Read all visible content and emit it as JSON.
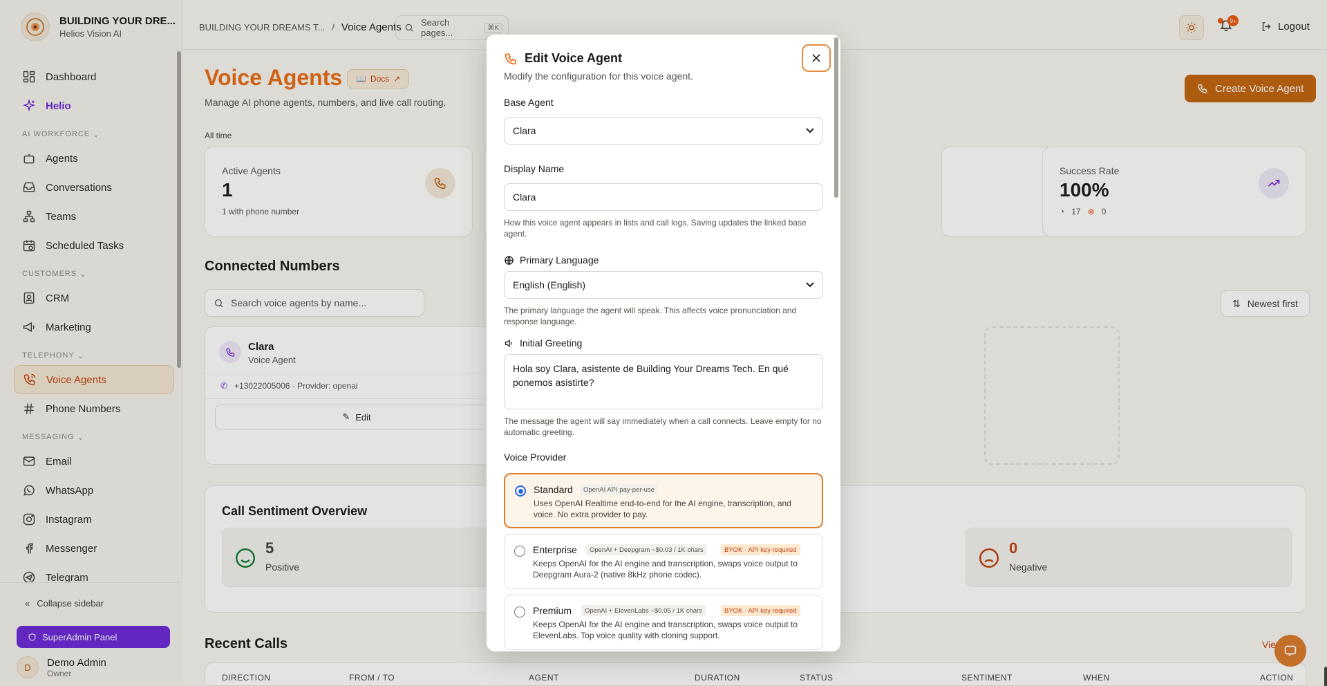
{
  "brand": {
    "name": "BUILDING YOUR DRE...",
    "sub": "Helios Vision AI"
  },
  "sidebar": {
    "items": [
      {
        "label": "Dashboard"
      },
      {
        "label": "Helio"
      },
      {
        "section": "AI WORKFORCE"
      },
      {
        "label": "Agents"
      },
      {
        "label": "Conversations"
      },
      {
        "label": "Teams"
      },
      {
        "label": "Scheduled Tasks"
      },
      {
        "section": "CUSTOMERS"
      },
      {
        "label": "CRM"
      },
      {
        "label": "Marketing"
      },
      {
        "section": "TELEPHONY"
      },
      {
        "label": "Voice Agents"
      },
      {
        "label": "Phone Numbers"
      },
      {
        "section": "MESSAGING"
      },
      {
        "label": "Email"
      },
      {
        "label": "WhatsApp"
      },
      {
        "label": "Instagram"
      },
      {
        "label": "Messenger"
      },
      {
        "label": "Telegram"
      }
    ],
    "collapse": "Collapse sidebar",
    "superadmin": "SuperAdmin Panel",
    "user": {
      "initial": "D",
      "name": "Demo Admin",
      "role": "Owner"
    }
  },
  "header": {
    "breadcrumb_root": "BUILDING YOUR DREAMS T...",
    "breadcrumb_sep": "/",
    "breadcrumb_current": "Voice Agents",
    "search_placeholder": "Search pages...",
    "search_kbd": "⌘K",
    "notif_badge": "9+",
    "logout": "Logout"
  },
  "page": {
    "title": "Voice Agents",
    "docs": "Docs",
    "subtitle": "Manage AI phone agents, numbers, and live call routing.",
    "create": "Create Voice Agent",
    "period": "All time"
  },
  "stats": {
    "active": {
      "label": "Active Agents",
      "value": "1",
      "note": "1 with phone number"
    },
    "success": {
      "label": "Success Rate",
      "value": "100%",
      "ok": "17",
      "fail": "0"
    }
  },
  "connected": {
    "title": "Connected Numbers",
    "search_placeholder": "Search voice agents by name...",
    "sort": "Newest first",
    "card": {
      "name": "Clara",
      "type": "Voice Agent",
      "phone": "+13022005006 · Provider: openai",
      "edit": "Edit"
    }
  },
  "sentiment": {
    "title": "Call Sentiment Overview",
    "positive": {
      "value": "5",
      "label": "Positive"
    },
    "negative": {
      "value": "0",
      "label": "Negative"
    }
  },
  "recent": {
    "title": "Recent Calls",
    "view_all": "View all",
    "columns": [
      "DIRECTION",
      "FROM / TO",
      "AGENT",
      "DURATION",
      "STATUS",
      "SENTIMENT",
      "WHEN",
      "ACTION"
    ]
  },
  "modal": {
    "title": "Edit Voice Agent",
    "desc": "Modify the configuration for this voice agent.",
    "base_agent": {
      "label": "Base Agent",
      "value": "Clara"
    },
    "display_name": {
      "label": "Display Name",
      "value": "Clara",
      "help": "How this voice agent appears in lists and call logs. Saving updates the linked base agent."
    },
    "language": {
      "label": "Primary Language",
      "value": "English (English)",
      "help": "The primary language the agent will speak. This affects voice pronunciation and response language."
    },
    "greeting": {
      "label": "Initial Greeting",
      "value": "Hola soy Clara, asistente de Building Your Dreams Tech. En qué ponemos asistirte?",
      "help": "The message the agent will say immediately when a call connects. Leave empty for no automatic greeting."
    },
    "provider": {
      "label": "Voice Provider",
      "options": [
        {
          "name": "Standard",
          "chip": "OpenAI API pay-per-use",
          "byok": "",
          "desc": "Uses OpenAI Realtime end-to-end for the AI engine, transcription, and voice. No extra provider to pay.",
          "selected": true
        },
        {
          "name": "Enterprise",
          "chip": "OpenAI + Deepgram ~$0.03 / 1K chars",
          "byok": "BYOK · API key required",
          "desc": "Keeps OpenAI for the AI engine and transcription, swaps voice output to Deepgram Aura-2 (native 8kHz phone codec).",
          "selected": false
        },
        {
          "name": "Premium",
          "chip": "OpenAI + ElevenLabs ~$0.05 / 1K chars",
          "byok": "BYOK · API key required",
          "desc": "Keeps OpenAI for the AI engine and transcription, swaps voice output to ElevenLabs. Top voice quality with cloning support.",
          "selected": false
        }
      ]
    }
  },
  "colors": {
    "accent": "#c2640d",
    "helio": "#6d28d9",
    "radio": "#2563eb"
  }
}
